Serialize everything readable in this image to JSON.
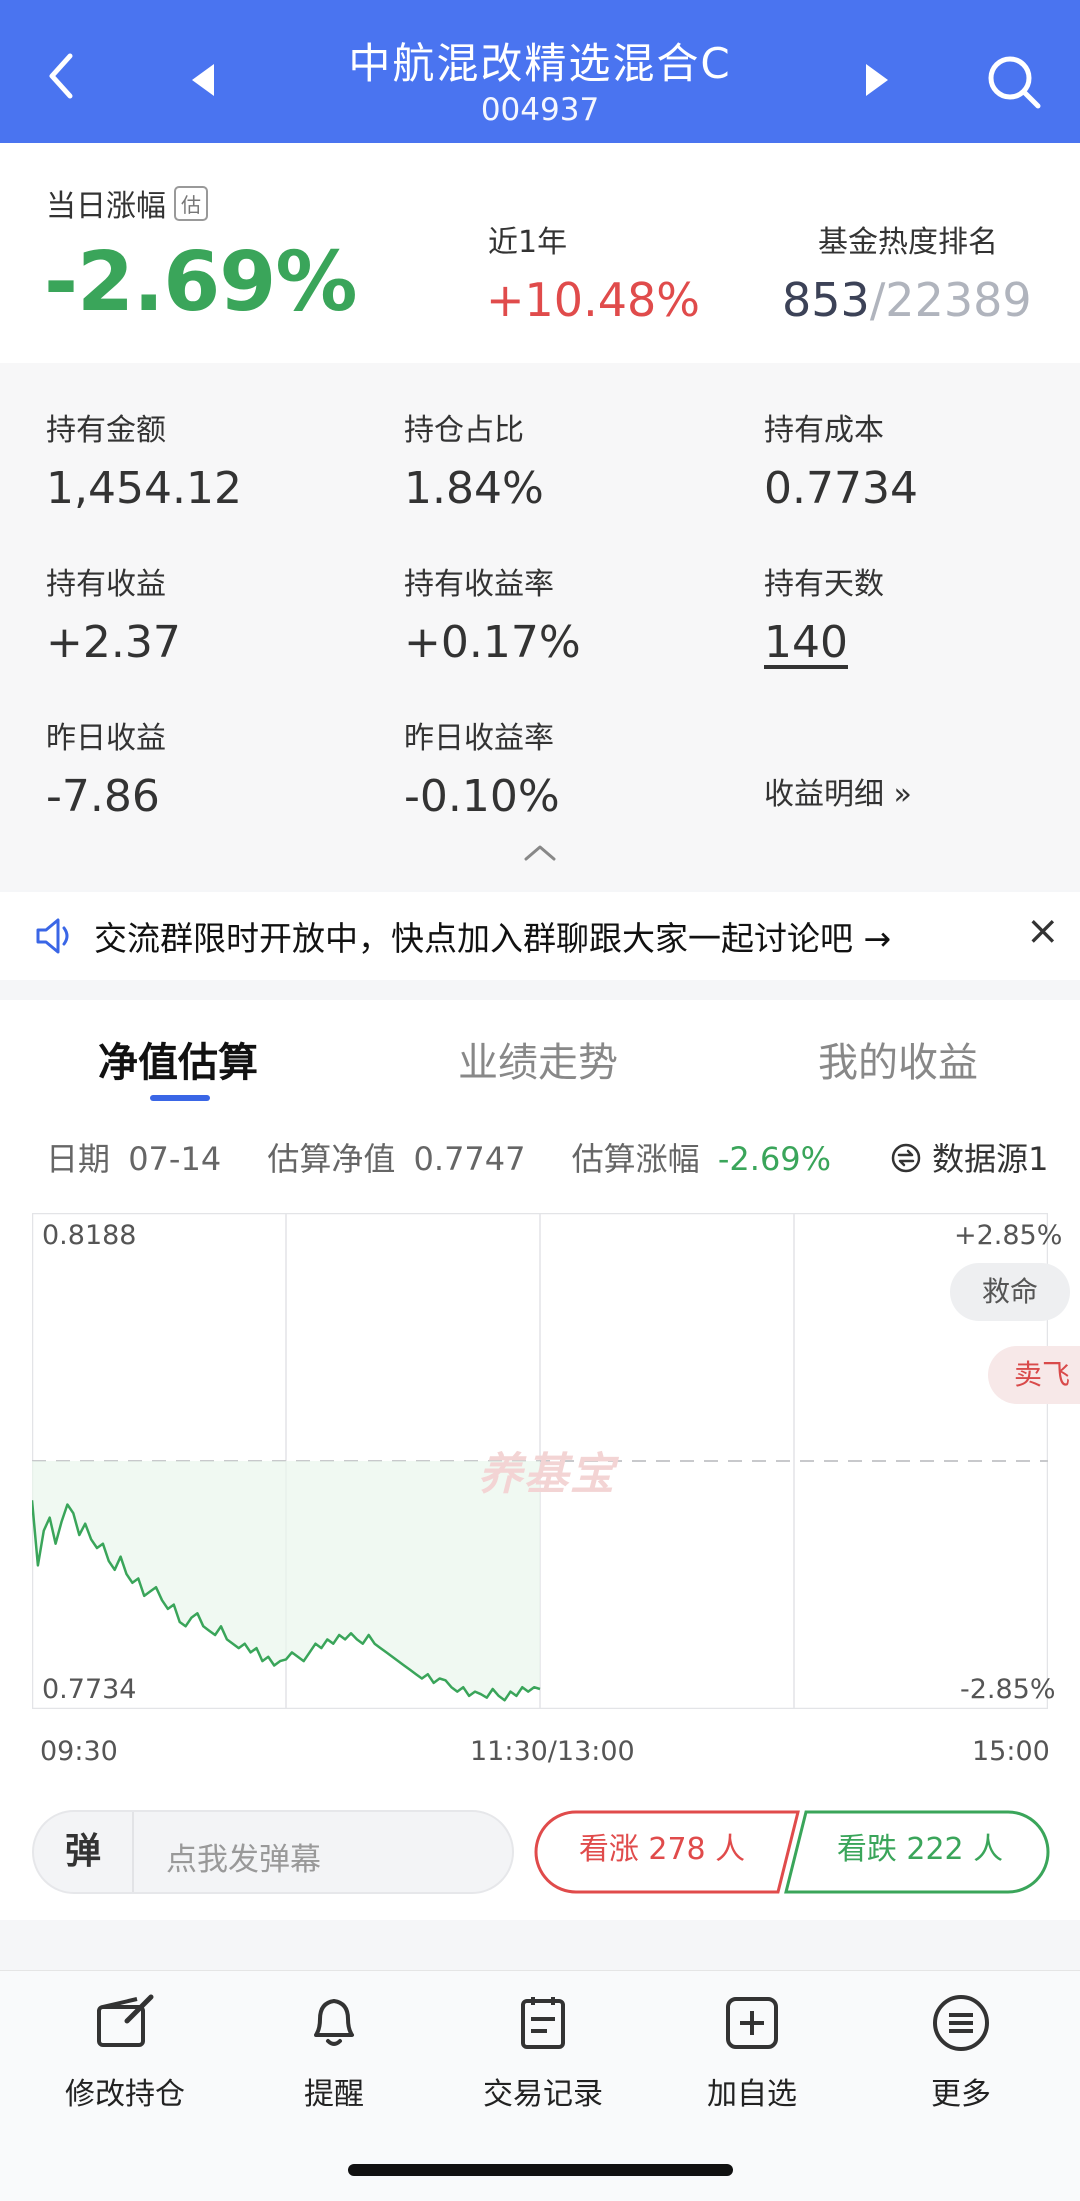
{
  "header": {
    "title": "中航混改精选混合C",
    "code": "004937"
  },
  "summary": {
    "daily_change_label": "当日涨幅",
    "estimate_badge": "估",
    "daily_change_value": "-2.69%",
    "one_year_label": "近1年",
    "one_year_value": "+10.48%",
    "heat_rank_label": "基金热度排名",
    "heat_rank_value": "853",
    "heat_rank_total": "/22389"
  },
  "holdings": {
    "amount_label": "持有金额",
    "amount_value": "1,454.12",
    "ratio_label": "持仓占比",
    "ratio_value": "1.84%",
    "cost_label": "持有成本",
    "cost_value": "0.7734",
    "profit_label": "持有收益",
    "profit_value": "+2.37",
    "profit_rate_label": "持有收益率",
    "profit_rate_value": "+0.17%",
    "days_label": "持有天数",
    "days_value": "140",
    "yday_profit_label": "昨日收益",
    "yday_profit_value": "-7.86",
    "yday_rate_label": "昨日收益率",
    "yday_rate_value": "-0.10%",
    "detail_link": "收益明细 »"
  },
  "notice": {
    "text": "交流群限时开放中，快点加入群聊跟大家一起讨论吧 →",
    "close": "×"
  },
  "tabs": [
    {
      "label": "净值估算"
    },
    {
      "label": "业绩走势"
    },
    {
      "label": "我的收益"
    }
  ],
  "info": {
    "date_label": "日期",
    "date_value": "07-14",
    "nav_label": "估算净值",
    "nav_value": "0.7747",
    "change_label": "估算涨幅",
    "change_value": "-2.69%",
    "source": "数据源1"
  },
  "chart_data": {
    "type": "line",
    "x_ticks": [
      "09:30",
      "11:30/13:00",
      "15:00"
    ],
    "y_left": [
      "0.8188",
      "0.7734"
    ],
    "y_right": [
      "+2.85%",
      "-2.85%"
    ],
    "watermark": "养基宝",
    "ylim_pct": [
      -2.85,
      2.85
    ],
    "series": [
      {
        "values": [
          -0.45,
          -1.2,
          -0.8,
          -0.65,
          -0.95,
          -0.7,
          -0.5,
          -0.6,
          -0.85,
          -0.72,
          -0.9,
          -1.0,
          -0.95,
          -1.15,
          -1.25,
          -1.1,
          -1.3,
          -1.4,
          -1.35,
          -1.55,
          -1.5,
          -1.45,
          -1.6,
          -1.7,
          -1.65,
          -1.85,
          -1.9,
          -1.8,
          -1.75,
          -1.9,
          -1.95,
          -2.0,
          -1.9,
          -2.05,
          -2.1,
          -2.15,
          -2.1,
          -2.2,
          -2.15,
          -2.3,
          -2.25,
          -2.35,
          -2.3,
          -2.28,
          -2.2,
          -2.25,
          -2.3,
          -2.2,
          -2.1,
          -2.15,
          -2.05,
          -2.1,
          -2.0,
          -2.05,
          -1.98,
          -2.05,
          -2.1,
          -2.0,
          -2.1,
          -2.15,
          -2.2,
          -2.25,
          -2.3,
          -2.35,
          -2.4,
          -2.45,
          -2.5,
          -2.45,
          -2.55,
          -2.5,
          -2.52,
          -2.6,
          -2.65,
          -2.6,
          -2.7,
          -2.65,
          -2.68,
          -2.72,
          -2.62,
          -2.7,
          -2.75,
          -2.65,
          -2.7,
          -2.6,
          -2.65,
          -2.6,
          -2.62
        ]
      }
    ],
    "side_pills": [
      "救命",
      "卖飞"
    ]
  },
  "danmu": {
    "icon": "弹",
    "placeholder": "点我发弹幕"
  },
  "vote": {
    "up": "看涨 278 人",
    "down": "看跌 222 人"
  },
  "toolbar": [
    {
      "label": "修改持仓"
    },
    {
      "label": "提醒"
    },
    {
      "label": "交易记录"
    },
    {
      "label": "加自选"
    },
    {
      "label": "更多"
    }
  ]
}
